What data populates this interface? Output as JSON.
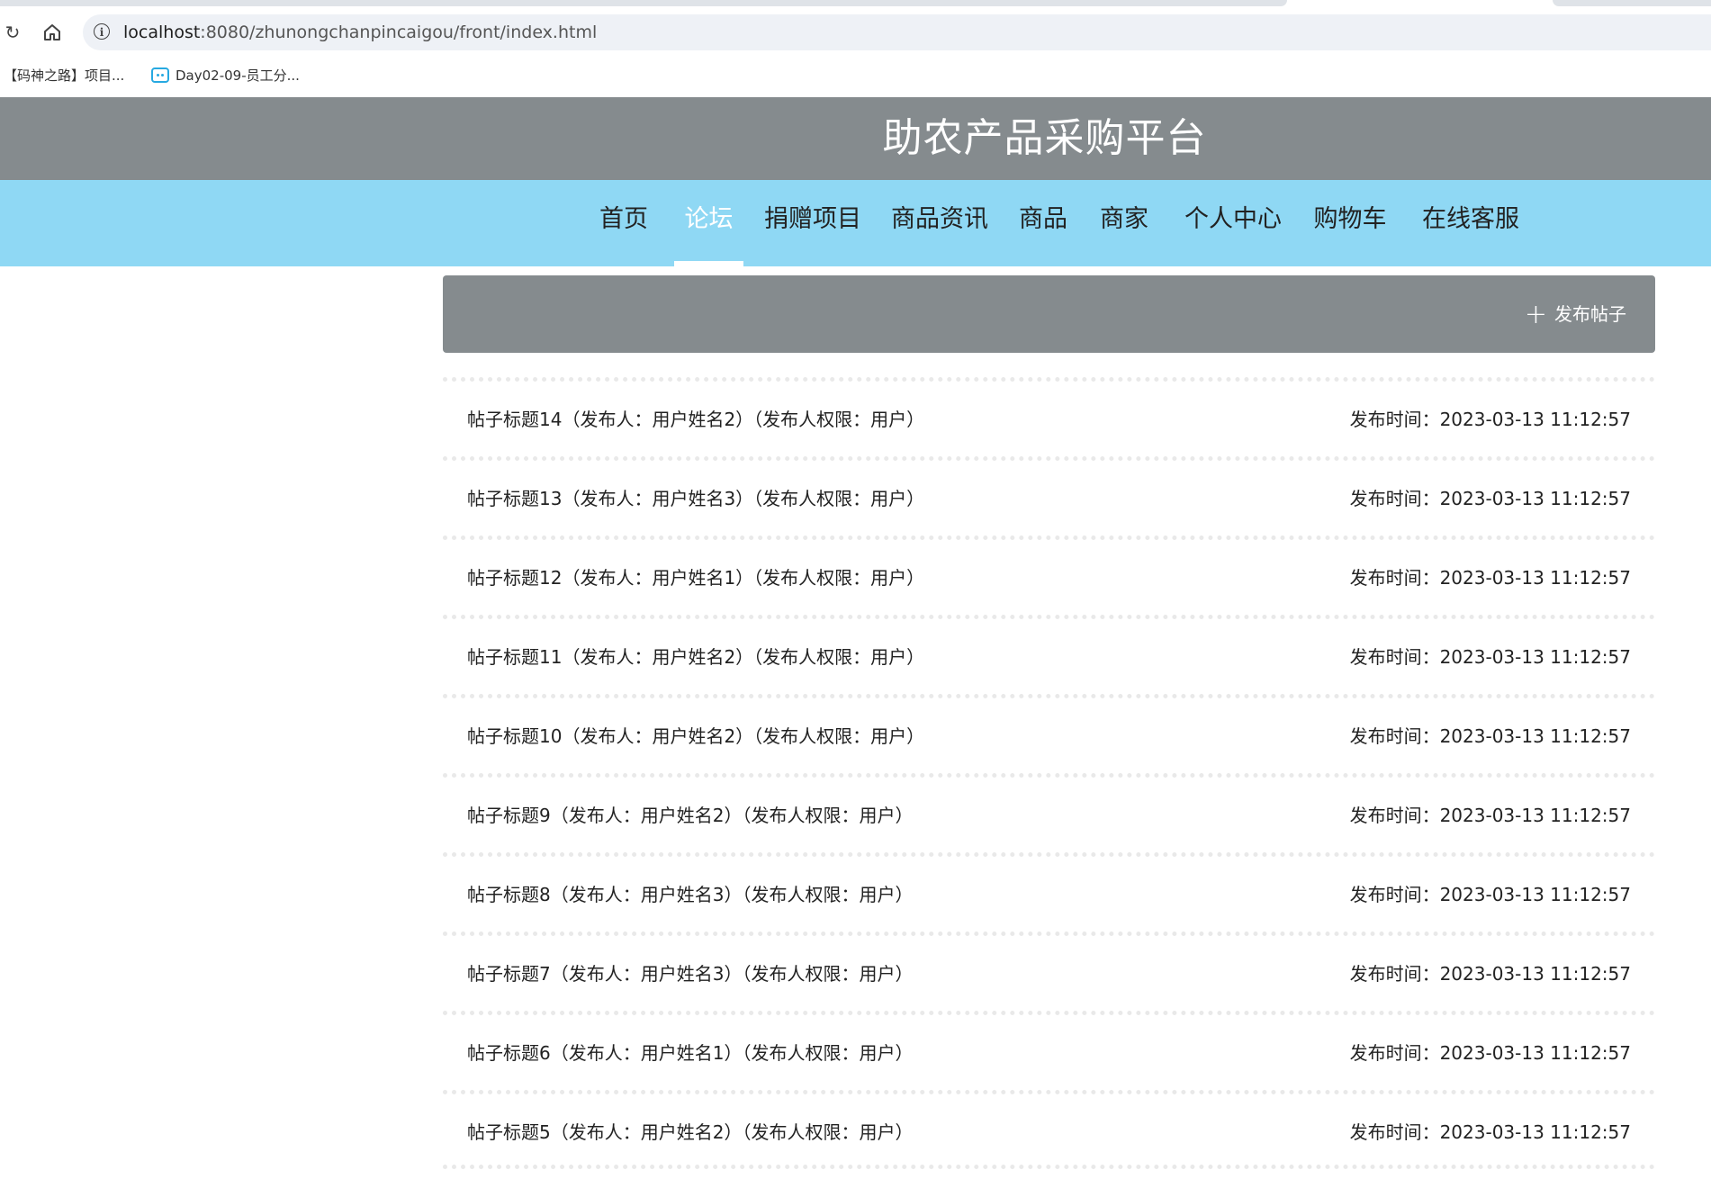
{
  "browser": {
    "url_host": "localhost",
    "url_rest": ":8080/zhunongchanpincaigou/front/index.html",
    "bookmarks": [
      "【码神之路】项目...",
      "Day02-09-员工分..."
    ]
  },
  "site": {
    "title": "助农产品采购平台",
    "nav": [
      "首页",
      "论坛",
      "捐赠项目",
      "商品资讯",
      "商品",
      "商家",
      "个人中心",
      "购物车",
      "在线客服"
    ],
    "active_nav": "论坛"
  },
  "forum": {
    "post_button": "发布帖子",
    "posts": [
      {
        "title": "帖子标题14（发布人：用户姓名2）（发布人权限：用户）",
        "time": "发布时间：2023-03-13 11:12:57"
      },
      {
        "title": "帖子标题13（发布人：用户姓名3）（发布人权限：用户）",
        "time": "发布时间：2023-03-13 11:12:57"
      },
      {
        "title": "帖子标题12（发布人：用户姓名1）（发布人权限：用户）",
        "time": "发布时间：2023-03-13 11:12:57"
      },
      {
        "title": "帖子标题11（发布人：用户姓名2）（发布人权限：用户）",
        "time": "发布时间：2023-03-13 11:12:57"
      },
      {
        "title": "帖子标题10（发布人：用户姓名2）（发布人权限：用户）",
        "time": "发布时间：2023-03-13 11:12:57"
      },
      {
        "title": "帖子标题9（发布人：用户姓名2）（发布人权限：用户）",
        "time": "发布时间：2023-03-13 11:12:57"
      },
      {
        "title": "帖子标题8（发布人：用户姓名3）（发布人权限：用户）",
        "time": "发布时间：2023-03-13 11:12:57"
      },
      {
        "title": "帖子标题7（发布人：用户姓名3）（发布人权限：用户）",
        "time": "发布时间：2023-03-13 11:12:57"
      },
      {
        "title": "帖子标题6（发布人：用户姓名1）（发布人权限：用户）",
        "time": "发布时间：2023-03-13 11:12:57"
      },
      {
        "title": "帖子标题5（发布人：用户姓名2）（发布人权限：用户）",
        "time": "发布时间：2023-03-13 11:12:57"
      }
    ]
  }
}
